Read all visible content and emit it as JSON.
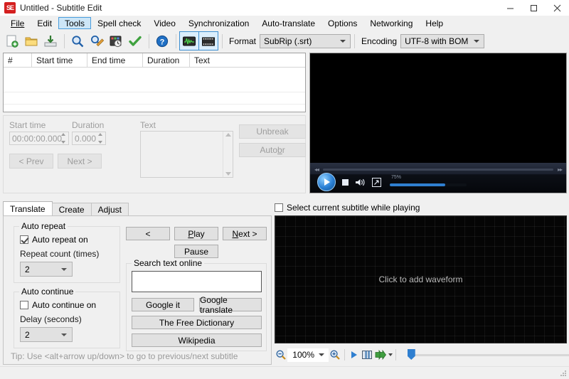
{
  "window": {
    "title": "Untitled - Subtitle Edit",
    "icon": "subtitle-edit-icon",
    "minimize": "—",
    "maximize": "☐",
    "close": "✕"
  },
  "menu": {
    "items": [
      {
        "label": "File",
        "mnemonic": "F",
        "active": false
      },
      {
        "label": "Edit",
        "mnemonic": "",
        "active": false
      },
      {
        "label": "Tools",
        "mnemonic": "",
        "active": true
      },
      {
        "label": "Spell check",
        "mnemonic": "",
        "active": false
      },
      {
        "label": "Video",
        "mnemonic": "",
        "active": false
      },
      {
        "label": "Synchronization",
        "mnemonic": "",
        "active": false
      },
      {
        "label": "Auto-translate",
        "mnemonic": "",
        "active": false
      },
      {
        "label": "Options",
        "mnemonic": "",
        "active": false
      },
      {
        "label": "Networking",
        "mnemonic": "",
        "active": false
      },
      {
        "label": "Help",
        "mnemonic": "",
        "active": false
      }
    ]
  },
  "toolbar": {
    "buttons": [
      {
        "name": "new-subtitle-icon",
        "title": "New"
      },
      {
        "name": "open-folder-icon",
        "title": "Open"
      },
      {
        "name": "save-icon",
        "title": "Save"
      },
      {
        "name": "find-icon",
        "title": "Find"
      },
      {
        "name": "replace-icon",
        "title": "Replace"
      },
      {
        "name": "fix-common-errors-icon",
        "title": "Fix common errors"
      },
      {
        "name": "spell-check-icon",
        "title": "Spell check"
      },
      {
        "name": "help-icon",
        "title": "Help"
      },
      {
        "name": "toggle-waveform-icon",
        "title": "Show/hide waveform"
      },
      {
        "name": "toggle-video-icon",
        "title": "Show/hide video"
      }
    ],
    "format_label": "Format",
    "format_value": "SubRip (.srt)",
    "encoding_label": "Encoding",
    "encoding_value": "UTF-8 with BOM"
  },
  "subtitle_list": {
    "columns": [
      "#",
      "Start time",
      "End time",
      "Duration",
      "Text"
    ],
    "rows": []
  },
  "edit_panel": {
    "start_time_label": "Start time",
    "start_time_value": "00:00:00.000",
    "duration_label": "Duration",
    "duration_value": "0.000",
    "text_label": "Text",
    "text_value": "",
    "unbreak_label": "Unbreak",
    "autobr_label": "Auto br",
    "autobr_prefix": "Auto ",
    "autobr_mnemonic": "b",
    "autobr_suffix": "r",
    "prev_label": "< Prev",
    "next_label": "Next >"
  },
  "video": {
    "play": "play-button",
    "stop": "stop-button",
    "mute": "volume-icon",
    "fullscreen": "fullscreen-icon",
    "volume_text": "75%"
  },
  "tabs": {
    "items": [
      {
        "label": "Translate",
        "active": true
      },
      {
        "label": "Create",
        "active": false
      },
      {
        "label": "Adjust",
        "active": false
      }
    ]
  },
  "translate_tab": {
    "auto_repeat": {
      "group_title": "Auto repeat",
      "checkbox_label": "Auto repeat on",
      "checked": true,
      "count_label": "Repeat count (times)",
      "count_value": "2"
    },
    "auto_continue": {
      "group_title": "Auto continue",
      "checkbox_label": "Auto continue on",
      "checked": false,
      "delay_label": "Delay (seconds)",
      "delay_value": "2"
    },
    "playback": {
      "prev_label": "<",
      "play_prefix": "",
      "play_mnemonic": "P",
      "play_suffix": "lay",
      "next_prefix": "",
      "next_mnemonic": "N",
      "next_suffix": "ext >",
      "pause_label": "Pause"
    },
    "search_online": {
      "group_title": "Search text online",
      "input_value": "",
      "google_it_label": "Google it",
      "google_translate_label": "Google translate",
      "free_dictionary_label": "The Free Dictionary",
      "wikipedia_label": "Wikipedia"
    },
    "tip": "Tip: Use <alt+arrow up/down> to go to previous/next subtitle"
  },
  "waveform": {
    "select_while_playing_label": "Select current subtitle while playing",
    "select_while_playing_checked": false,
    "placeholder": "Click to add waveform",
    "zoom_value": "100%",
    "toolbar_icons": [
      {
        "name": "zoom-out-icon"
      },
      {
        "name": "zoom-in-icon"
      },
      {
        "name": "play-waveform-icon"
      },
      {
        "name": "shot-changes-icon"
      },
      {
        "name": "fast-forward-icon"
      }
    ]
  },
  "colors": {
    "accent_blue": "#2f7fd0",
    "menu_highlight": "#cde6f7",
    "window_bg": "#f0f0f0",
    "waveform_bg": "#050505"
  }
}
